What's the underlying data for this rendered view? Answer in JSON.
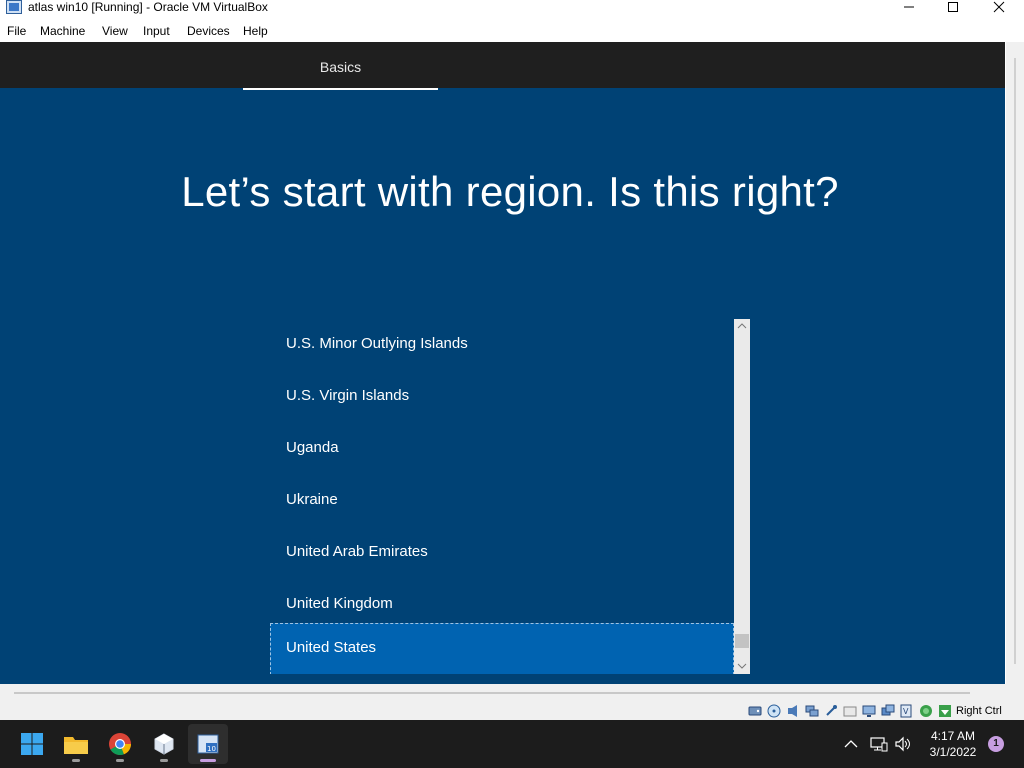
{
  "window": {
    "title": "atlas win10 [Running] - Oracle VM VirtualBox",
    "controls": [
      "minimize-icon",
      "maximize-icon",
      "close-icon"
    ]
  },
  "menu": {
    "items": [
      {
        "label": "File"
      },
      {
        "label": "Machine"
      },
      {
        "label": "View"
      },
      {
        "label": "Input"
      },
      {
        "label": "Devices"
      },
      {
        "label": "Help"
      }
    ]
  },
  "guest": {
    "tab_label": "Basics",
    "heading": "Let’s start with region. Is this right?",
    "regions": [
      {
        "label": "U.S. Minor Outlying Islands",
        "selected": false
      },
      {
        "label": "U.S. Virgin Islands",
        "selected": false
      },
      {
        "label": "Uganda",
        "selected": false
      },
      {
        "label": "Ukraine",
        "selected": false
      },
      {
        "label": "United Arab Emirates",
        "selected": false
      },
      {
        "label": "United Kingdom",
        "selected": false
      },
      {
        "label": "United States",
        "selected": true
      }
    ],
    "colors": {
      "background": "#004275",
      "selected": "#0063b1",
      "topbar": "#1f1f1f"
    }
  },
  "status_bar": {
    "host_key": "Right Ctrl",
    "icons": [
      "hard-disk-icon",
      "optical-drive-icon",
      "audio-icon",
      "network-icon",
      "usb-icon",
      "shared-folders-icon",
      "display-icon",
      "video-capture-icon",
      "recording-icon",
      "cpu-icon",
      "mouse-integration-icon",
      "keyboard-icon"
    ]
  },
  "taskbar": {
    "apps": [
      "windows-start-icon",
      "file-explorer-icon",
      "chrome-icon",
      "virtualbox-manager-icon",
      "virtualbox-vm-icon"
    ],
    "tray_icons": [
      "chevron-up-icon",
      "network-icon",
      "speaker-icon"
    ],
    "time": "4:17 AM",
    "date": "3/1/2022",
    "notification_count": "1"
  }
}
